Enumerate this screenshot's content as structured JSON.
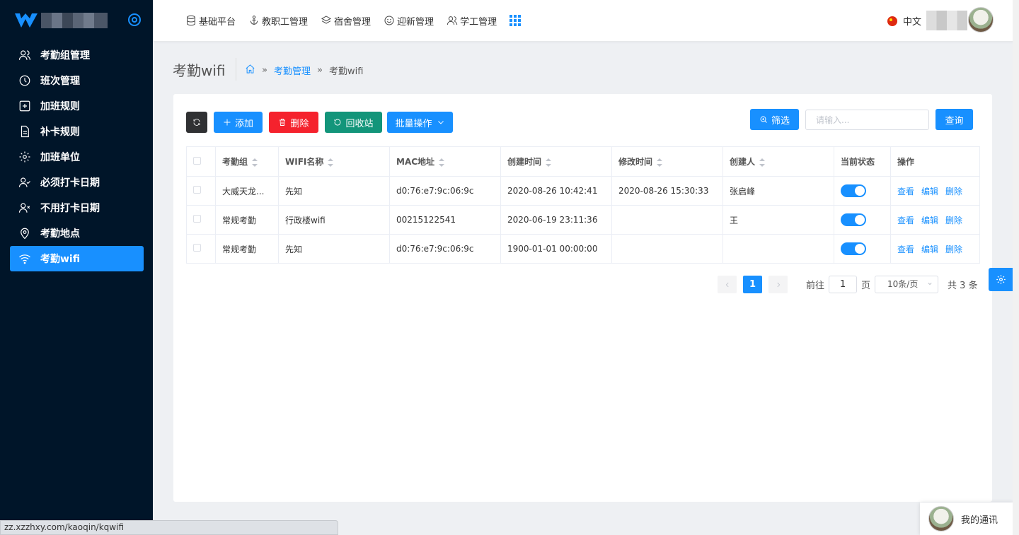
{
  "sidebar": {
    "items": [
      {
        "label": "考勤组管理",
        "icon": "users-icon"
      },
      {
        "label": "班次管理",
        "icon": "clock-icon"
      },
      {
        "label": "加班规则",
        "icon": "plus-square-icon"
      },
      {
        "label": "补卡规则",
        "icon": "file-icon"
      },
      {
        "label": "加班单位",
        "icon": "gear-icon"
      },
      {
        "label": "必须打卡日期",
        "icon": "user-check-icon"
      },
      {
        "label": "不用打卡日期",
        "icon": "user-x-icon"
      },
      {
        "label": "考勤地点",
        "icon": "location-icon"
      },
      {
        "label": "考勤wifi",
        "icon": "wifi-icon",
        "active": true
      }
    ]
  },
  "topnav": {
    "items": [
      {
        "label": "基础平台",
        "icon": "database-icon"
      },
      {
        "label": "教职工管理",
        "icon": "anchor-icon"
      },
      {
        "label": "宿舍管理",
        "icon": "layers-icon"
      },
      {
        "label": "迎新管理",
        "icon": "smile-icon"
      },
      {
        "label": "学工管理",
        "icon": "users-icon"
      }
    ],
    "lang": "中文"
  },
  "page": {
    "title": "考勤wifi",
    "breadcrumb": {
      "sep": "»",
      "parent": "考勤管理",
      "current": "考勤wifi"
    }
  },
  "toolbar": {
    "add": "添加",
    "delete": "删除",
    "recycle": "回收站",
    "batch": "批量操作",
    "filter": "筛选",
    "search_placeholder": "请输入...",
    "query": "查询"
  },
  "table": {
    "headers": [
      "考勤组",
      "WIFI名称",
      "MAC地址",
      "创建时间",
      "修改时间",
      "创建人",
      "当前状态",
      "操作"
    ],
    "rows": [
      {
        "group": "大威天龙...",
        "wifi": "先知",
        "mac": "d0:76:e7:9c:06:9c",
        "created": "2020-08-26 10:42:41",
        "modified": "2020-08-26 15:30:33",
        "creator": "张启峰",
        "enabled": true
      },
      {
        "group": "常规考勤",
        "wifi": "行政楼wifi",
        "mac": "00215122541",
        "created": "2020-06-19 23:11:36",
        "modified": "",
        "creator": "王",
        "enabled": true
      },
      {
        "group": "常规考勤",
        "wifi": "先知",
        "mac": "d0:76:e7:9c:06:9c",
        "created": "1900-01-01 00:00:00",
        "modified": "",
        "creator": "",
        "enabled": true
      }
    ],
    "ops": {
      "view": "查看",
      "edit": "编辑",
      "delete": "删除"
    }
  },
  "pagination": {
    "current": "1",
    "jump_prefix": "前往",
    "jump_value": "1",
    "jump_suffix": "页",
    "page_size": "10条/页",
    "total": "共 3 条"
  },
  "chat": {
    "label": "我的通讯"
  },
  "statusbar": {
    "url": "zz.xzzhxy.com/kaoqin/kqwifi"
  },
  "colors": {
    "primary": "#1890ff",
    "sidebar_bg": "#001529",
    "danger": "#f5222d",
    "success": "#13957a",
    "dark": "#303133"
  }
}
